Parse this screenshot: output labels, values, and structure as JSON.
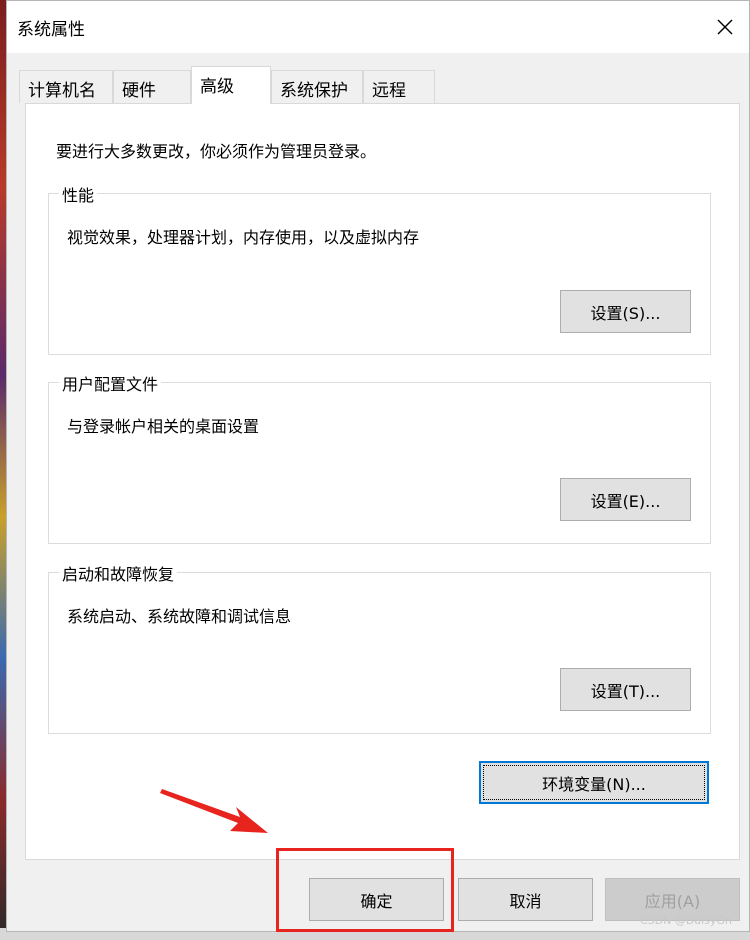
{
  "window": {
    "title": "系统属性",
    "close_glyph": "✕"
  },
  "tabs": [
    {
      "label": "计算机名",
      "active": false
    },
    {
      "label": "硬件",
      "active": false
    },
    {
      "label": "高级",
      "active": true
    },
    {
      "label": "系统保护",
      "active": false
    },
    {
      "label": "远程",
      "active": false
    }
  ],
  "advanced": {
    "intro": "要进行大多数更改，你必须作为管理员登录。",
    "groups": [
      {
        "title": "性能",
        "description": "视觉效果，处理器计划，内存使用，以及虚拟内存",
        "button": "设置(S)..."
      },
      {
        "title": "用户配置文件",
        "description": "与登录帐户相关的桌面设置",
        "button": "设置(E)..."
      },
      {
        "title": "启动和故障恢复",
        "description": "系统启动、系统故障和调试信息",
        "button": "设置(T)..."
      }
    ],
    "env_button": "环境变量(N)..."
  },
  "footer": {
    "ok": "确定",
    "cancel": "取消",
    "apply": "应用(A)"
  },
  "annotation": {
    "highlight_color": "#e8241f"
  },
  "watermark": "CSDN @DaisyGn"
}
